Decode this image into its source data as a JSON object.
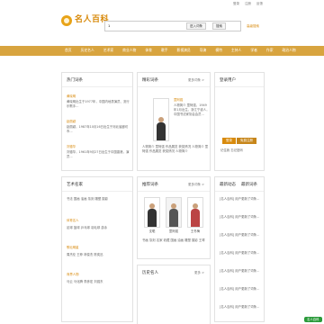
{
  "topbar": {
    "links": [
      "登录",
      "注册",
      "反馈"
    ]
  },
  "header": {
    "logo_text": "名人百科",
    "search_value": "1",
    "search_btn1": "进入词条",
    "search_btn2": "搜索",
    "hot_link": "高级搜索"
  },
  "nav": {
    "items": [
      "首页",
      "历史名人",
      "艺术家",
      "商业人物",
      "体育",
      "歌手",
      "影视演员",
      "导演",
      "模特",
      "主持人",
      "学者",
      "作家",
      "政治人物"
    ]
  },
  "left_top": {
    "title": "热门词条",
    "more": "更多词条 >",
    "entries": [
      {
        "name": "黄晓明",
        "text": "黄晓明出生于1977年，中国内地男演员、流行乐歌手..."
      },
      {
        "name": "赵丽颖",
        "text": "赵丽颖，1987年10月16日出生于河北省廊坊市..."
      },
      {
        "name": "刘德华",
        "text": "刘德华，1961年9月27日出生于中国香港，演员..."
      }
    ]
  },
  "mid_top": {
    "title": "精彩词条",
    "more": "更多词条 >",
    "name": "童阿强",
    "desc": "人物简介 童阿强，1949年1月出生，浙江宁波人，中国书法家协会会员...",
    "desc2": "人物简介 童阿强 作品展览 获奖情况 人物简介 童阿强 作品展览 获奖情况 人物简介"
  },
  "right_top": {
    "title": "登录用户",
    "btn_login": "登录",
    "btn_register": "免费注册",
    "hint": "记住我  忘记密码"
  },
  "left_mid": {
    "title": "艺术名家",
    "items": [
      "书法",
      "国画",
      "油画",
      "篆刻",
      "雕塑",
      "摄影"
    ],
    "group2_title": "体育名人",
    "group2_items": [
      "足球",
      "篮球",
      "乒乓球",
      "羽毛球",
      "游泳"
    ],
    "group3_title": "歌坛明星",
    "group3_items": [
      "周杰伦",
      "王菲",
      "林俊杰",
      "陈奕迅"
    ],
    "group4_title": "商界人物",
    "group4_items": [
      "马云",
      "马化腾",
      "李彦宏",
      "刘强东"
    ]
  },
  "mid_mid": {
    "title": "推荐词条",
    "more": "更多词条 >",
    "captions": [
      "沈聪",
      "童阿强",
      "王冬梅"
    ],
    "tags": [
      "书画",
      "篆刻",
      "名家",
      "收藏",
      "国画",
      "油画",
      "雕塑",
      "摄影",
      "王琴"
    ]
  },
  "right_mid": {
    "tabs": [
      "最新动态",
      "最新词条"
    ],
    "items": [
      "[名人百科] 用户更新了词条...",
      "[名人百科] 用户更新了词条...",
      "[名人百科] 用户更新了词条...",
      "[名人百科] 用户更新了词条...",
      "[名人百科] 用户更新了词条...",
      "[名人百科] 用户更新了词条...",
      "[名人百科] 用户更新了词条..."
    ]
  },
  "mid_bottom": {
    "title": "历史名人",
    "more": "更多 >"
  },
  "float": {
    "label": "名人百科"
  }
}
